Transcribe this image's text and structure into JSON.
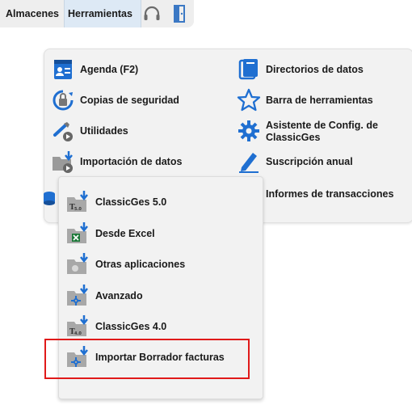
{
  "menubar": {
    "almacenes": "Almacenes",
    "herramientas": "Herramientas",
    "icons": [
      "headset-icon",
      "exit-door-icon"
    ]
  },
  "herramientas_menu": {
    "left_column": [
      {
        "label": "Agenda (F2)",
        "icon": "agenda-icon"
      },
      {
        "label": "Copias de seguridad",
        "icon": "backup-icon"
      },
      {
        "label": "Utilidades",
        "icon": "tools-icon"
      },
      {
        "label": "Importación de datos",
        "icon": "import-folder-icon"
      }
    ],
    "right_column": [
      {
        "label": "Directorios de datos",
        "icon": "directories-icon"
      },
      {
        "label": "Barra de herramientas",
        "icon": "star-icon"
      },
      {
        "label": "Asistente de Config. de ClassicGes",
        "icon": "gear-icon"
      },
      {
        "label": "Suscripción anual",
        "icon": "pen-icon"
      },
      {
        "label": "Informes de transacciones",
        "icon": ""
      }
    ]
  },
  "import_submenu": {
    "items": [
      {
        "label": "ClassicGes 5.0",
        "icon": "classicges-5-folder-icon"
      },
      {
        "label": "Desde Excel",
        "icon": "excel-folder-icon"
      },
      {
        "label": "Otras aplicaciones",
        "icon": "apps-folder-icon"
      },
      {
        "label": "Avanzado",
        "icon": "advanced-folder-icon"
      },
      {
        "label": "ClassicGes 4.0",
        "icon": "classicges-4-folder-icon"
      },
      {
        "label": "Importar Borrador facturas",
        "icon": "invoice-draft-folder-icon"
      }
    ],
    "highlighted": "Importar Borrador facturas"
  },
  "colors": {
    "highlight": "#e01a1a",
    "accent_blue": "#1f6fd1",
    "menu_bg": "#f2f2f2"
  }
}
